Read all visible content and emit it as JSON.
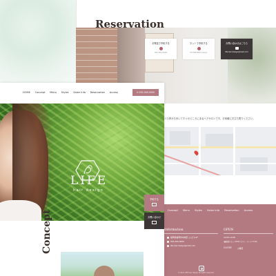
{
  "back_page": {
    "reservation_title": "Reservation",
    "cards": [
      {
        "label": "お電話で予約する",
        "sub": "092-000-0000"
      },
      {
        "label": "ネットで予約する",
        "sub": "HOTPEPPER beauty"
      },
      {
        "label": "お問い合わせはこちら",
        "sub": "life.hair.design@mail.com"
      }
    ],
    "access_text": "バス停から歩いてすぐのところにあるヘアサロンです。お気軽にお立ち寄りください。"
  },
  "footer": {
    "nav": [
      "Concept",
      "Menu",
      "Styles",
      "Salon Info",
      "Reservation",
      "Access"
    ],
    "information_heading": "Information",
    "open_heading": "OPEN",
    "info_items": [
      "福岡県福岡市中央区 ○○ビル1F",
      "092-000-0000",
      "life.hair.design@mail.com"
    ],
    "open_items": [
      "10:00-19:00",
      "(最終受付 カット18:00 / カラー・パーマ 17:00)"
    ],
    "close_heading": "CLOSE",
    "close_value": "火曜日",
    "copyright": "© 2021 LIFE hair design All rights reserved."
  },
  "front_page": {
    "nav_links": [
      "HOME",
      "Concept",
      "Menu",
      "Styles",
      "Salon Info",
      "Reservation",
      "Access"
    ],
    "nav_tel": "092-000-0000",
    "logo_text": "LIFE",
    "logo_sub": "hair design",
    "side_buttons": [
      {
        "label": "予約する"
      },
      {
        "label": "お問い合わせ"
      }
    ],
    "concept_title": "Concept"
  },
  "colors": {
    "brand_pink": "#b47a82",
    "dark": "#3d3737"
  }
}
